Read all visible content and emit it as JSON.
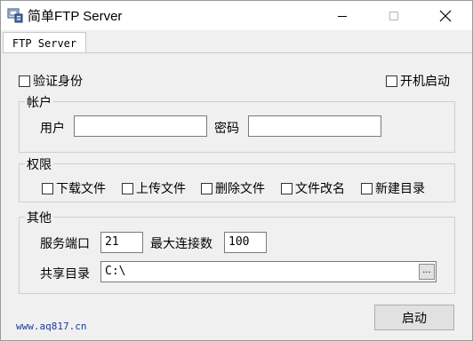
{
  "window": {
    "title": "简单FTP Server",
    "app_icon": "ftp-server-icon"
  },
  "tab": {
    "label": "FTP Server"
  },
  "options": {
    "verify_identity": {
      "label": "验证身份",
      "checked": false
    },
    "auto_start": {
      "label": "开机启动",
      "checked": false
    }
  },
  "account": {
    "group_title": "帐户",
    "user_label": "用户",
    "user_value": "",
    "password_label": "密码",
    "password_value": ""
  },
  "permissions": {
    "group_title": "权限",
    "items": [
      {
        "label": "下载文件",
        "checked": false
      },
      {
        "label": "上传文件",
        "checked": false
      },
      {
        "label": "删除文件",
        "checked": false
      },
      {
        "label": "文件改名",
        "checked": false
      },
      {
        "label": "新建目录",
        "checked": false
      }
    ]
  },
  "other": {
    "group_title": "其他",
    "port_label": "服务端口",
    "port_value": "21",
    "max_conn_label": "最大连接数",
    "max_conn_value": "100",
    "share_dir_label": "共享目录",
    "share_dir_value": "C:\\",
    "browse_label": "..."
  },
  "footer": {
    "website": "www.aq817.cn",
    "start_button": "启动"
  }
}
